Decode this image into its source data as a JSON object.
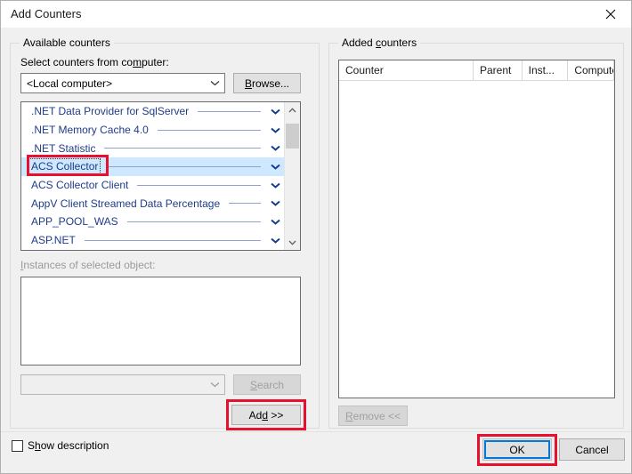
{
  "window": {
    "title": "Add Counters",
    "close_icon": "close-icon"
  },
  "available": {
    "legend_pre": "Available counters",
    "select_label_a": "Select counters from co",
    "select_label_accel": "m",
    "select_label_b": "puter:",
    "computer_combo_value": "<Local computer>",
    "browse": {
      "accel": "B",
      "rest": "rowse..."
    },
    "counters": [
      {
        "name": ".NET Data Provider for SqlServer",
        "selected": false
      },
      {
        "name": ".NET Memory Cache 4.0",
        "selected": false
      },
      {
        "name": ".NET Statistic",
        "selected": false
      },
      {
        "name": "ACS Collector",
        "selected": true
      },
      {
        "name": "ACS Collector Client",
        "selected": false
      },
      {
        "name": "AppV Client Streamed Data Percentage",
        "selected": false
      },
      {
        "name": "APP_POOL_WAS",
        "selected": false
      },
      {
        "name": "ASP.NET",
        "selected": false
      }
    ],
    "instances_label_accel": "I",
    "instances_label_rest": "nstances of selected object:",
    "instances_items": [],
    "search_combo_value": "",
    "search_button": {
      "accel": "S",
      "pre": "",
      "rest": "earch"
    },
    "add_button": {
      "pre": "Ad",
      "accel": "d",
      "rest": " >>"
    }
  },
  "added": {
    "legend_pre": "Added ",
    "legend_accel": "c",
    "legend_post": "ounters",
    "columns": [
      "Counter",
      "Parent",
      "Inst...",
      "Computer"
    ],
    "rows": [],
    "remove_button": {
      "accel": "R",
      "rest": "emove <<"
    }
  },
  "footer": {
    "show_description": {
      "pre": "S",
      "accel": "h",
      "rest": "ow description"
    },
    "show_description_checked": false,
    "ok": "OK",
    "cancel": "Cancel"
  },
  "colors": {
    "dialog_background": "#f0f0f0",
    "counter_text": "#1f3c88",
    "selection": "#cde8ff",
    "annotation_red": "#e8112d",
    "focus_blue": "#0078d7"
  }
}
